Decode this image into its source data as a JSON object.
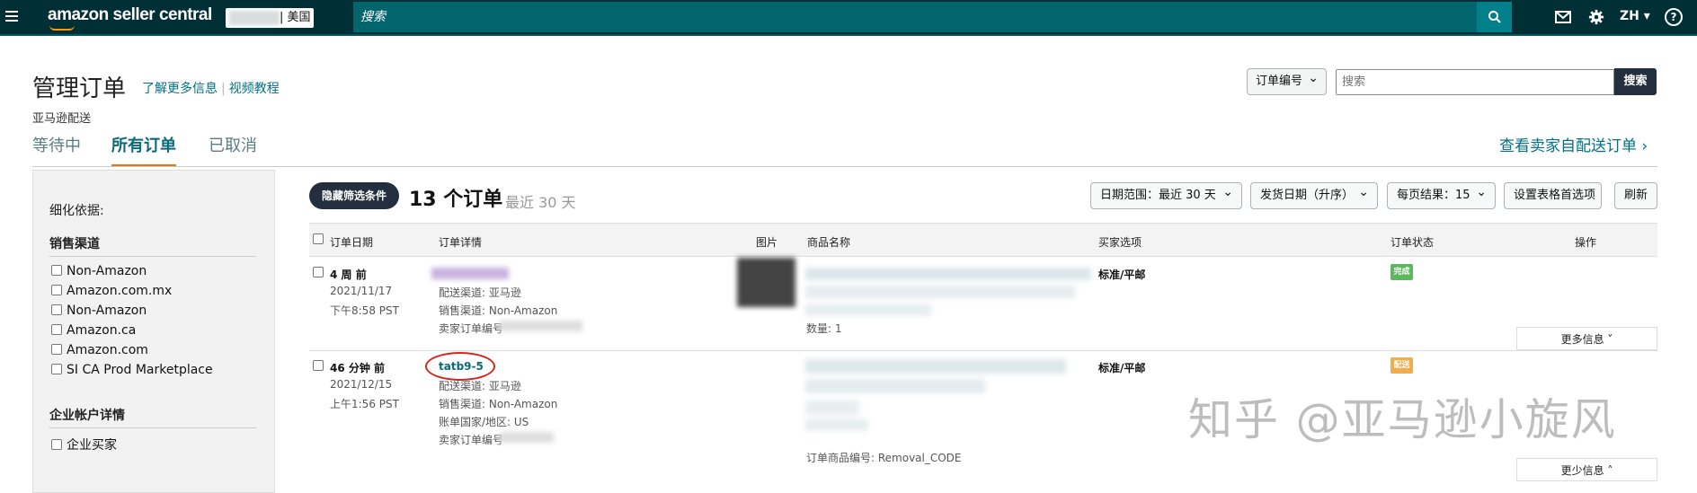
{
  "topbar": {
    "logo_text": "amazon seller central",
    "marketplace": "| 美国",
    "search_placeholder": "搜索",
    "lang": "ZH",
    "help": "?"
  },
  "header": {
    "title": "管理订单",
    "link_learn_more": "了解更多信息",
    "link_video": "视频教程",
    "sub_label": "亚马逊配送",
    "search_type": "订单编号",
    "search_placeholder": "搜索",
    "search_button": "搜索",
    "view_mfn": "查看卖家自配送订单 ›"
  },
  "tabs": [
    {
      "label": "等待中",
      "active": false
    },
    {
      "label": "所有订单",
      "active": true
    },
    {
      "label": "已取消",
      "active": false
    }
  ],
  "sidebar": {
    "refine_label": "细化依据:",
    "sales_channel_title": "销售渠道",
    "sales_channels": [
      "Non-Amazon",
      "Amazon.com.mx",
      "Non-Amazon",
      "Amazon.ca",
      "Amazon.com",
      "SI CA Prod Marketplace"
    ],
    "business_title": "企业帐户详情",
    "business_options": [
      "企业买家"
    ]
  },
  "results": {
    "hide_filters": "隐藏筛选条件",
    "count": "13 个订单",
    "range": "最近 30 天",
    "date_range": "日期范围：最近 30 天",
    "sort": "发货日期（升序）",
    "per_page": "每页结果：15",
    "table_prefs": "设置表格首选项",
    "refresh": "刷新"
  },
  "table": {
    "headers": [
      "订单日期",
      "订单详情",
      "图片",
      "商品名称",
      "买家选项",
      "订单状态",
      "操作"
    ],
    "rows": [
      {
        "age": "4 周 前",
        "date": "2021/11/17",
        "time": "下午8:58 PST",
        "order_id": "",
        "details": [
          "配送渠道: 亚马逊",
          "销售渠道: Non-Amazon",
          "卖家订单编号"
        ],
        "product_extra": "数量: 1",
        "buyer_option": "标准/平邮",
        "status": "完成",
        "status_color": "#5cb85c",
        "more": "更多信息 ˅"
      },
      {
        "age": "46 分钟 前",
        "date": "2021/12/15",
        "time": "上午1:56 PST",
        "order_id": "tatb9-5",
        "details": [
          "配送渠道: 亚马逊",
          "销售渠道: Non-Amazon",
          "账单国家/地区: US",
          "卖家订单编号"
        ],
        "product_extra": "订单商品编号: Removal_CODE",
        "buyer_option": "标准/平邮",
        "status": "配送",
        "status_color": "#f0ad4e",
        "more": "更少信息 ˄"
      }
    ]
  },
  "watermark": "知乎 @亚马逊小旋风",
  "colors": {
    "topbar": "#002f36",
    "accent": "#e47911",
    "link": "#007185"
  }
}
